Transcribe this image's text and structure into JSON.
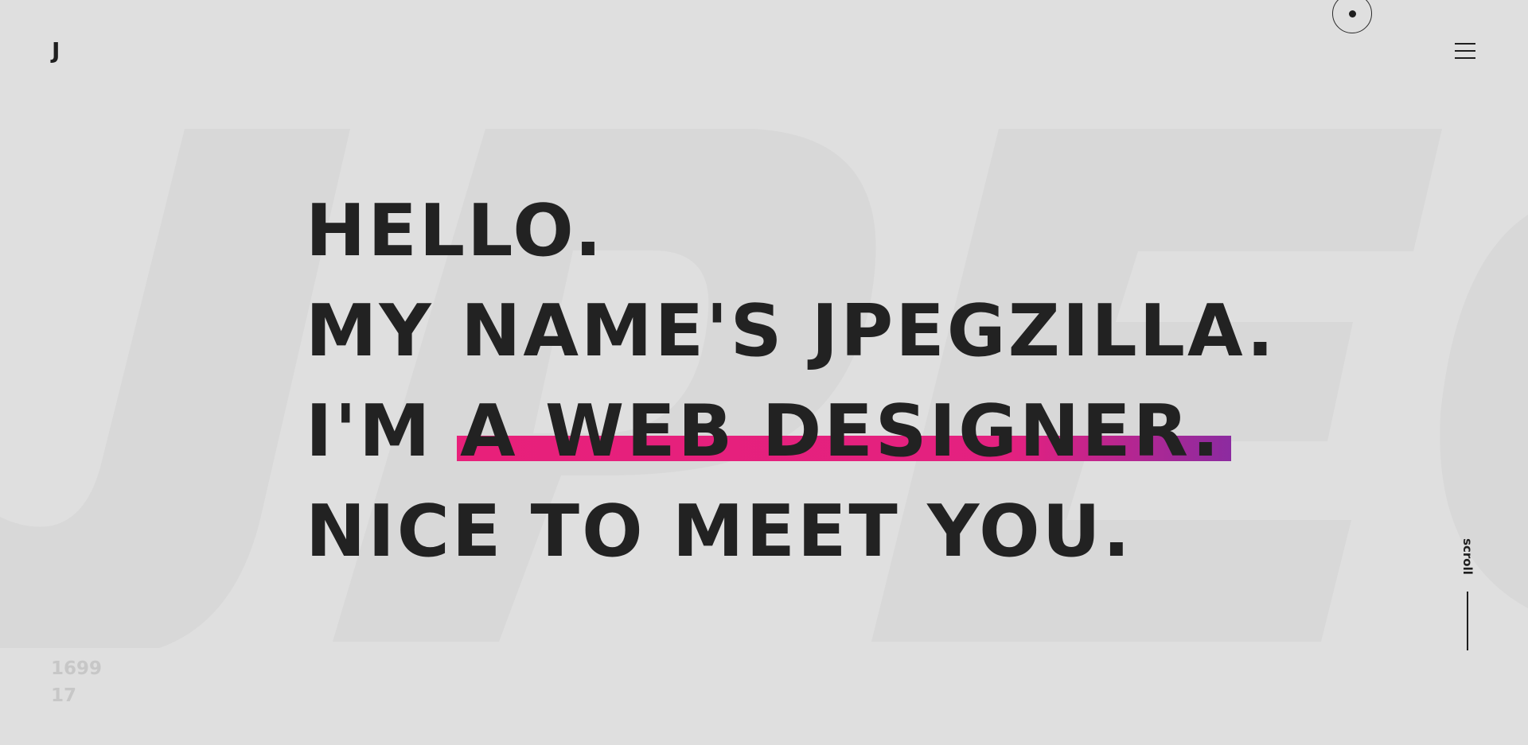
{
  "header": {
    "logo_text": "J",
    "menu_icon": "hamburger-menu-icon",
    "cursor_icon": "cursor-ring-icon"
  },
  "hero": {
    "lines": [
      "HELLO.",
      "MY NAME'S JPEGZILLA.",
      "I'M",
      "NICE TO MEET YOU."
    ],
    "highlight": "A WEB DESIGNER."
  },
  "counter": {
    "line1": "1699",
    "line2": "17"
  },
  "scroll": {
    "label": "scroll"
  },
  "colors": {
    "background": "#dfdfdf",
    "watermark": "#d8d8d8",
    "text": "#222222",
    "highlight_start": "#e8207a",
    "highlight_end": "#8c2ba0"
  }
}
